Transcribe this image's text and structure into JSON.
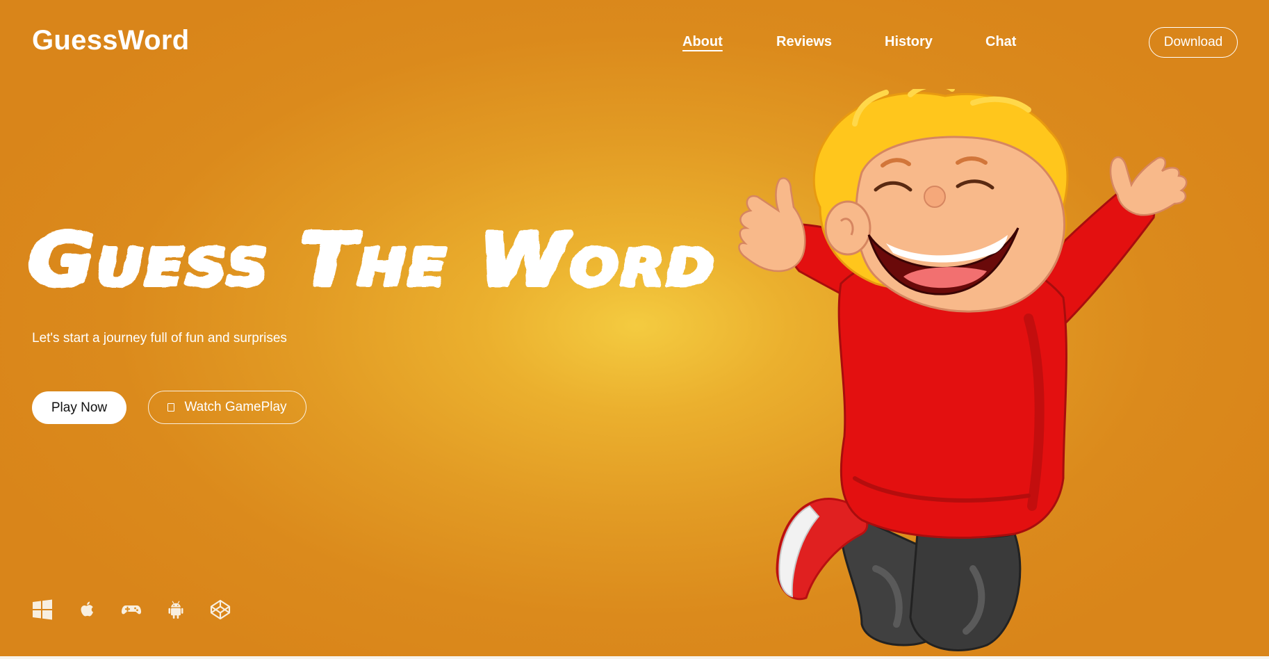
{
  "header": {
    "brand": "GuessWord",
    "nav": [
      "About",
      "Reviews",
      "History",
      "Chat"
    ],
    "active_nav": "About",
    "download_label": "Download"
  },
  "hero": {
    "title": "Guess The Word",
    "tagline": "Let's start a journey full of fun and surprises",
    "play_label": "Play Now",
    "watch_label": "Watch GamePlay",
    "watch_icon": "play-icon"
  },
  "platforms": [
    "windows-icon",
    "apple-icon",
    "gamepad-icon",
    "android-icon",
    "codepen-icon"
  ],
  "colors": {
    "background": "#dd8c1d",
    "background_glow": "#f4cb40",
    "text": "#ffffff",
    "button_fill": "#ffffff",
    "kid_shirt": "#e31010",
    "kid_hair": "#ffc61c"
  },
  "illustration": "cartoon-boy-jumping"
}
